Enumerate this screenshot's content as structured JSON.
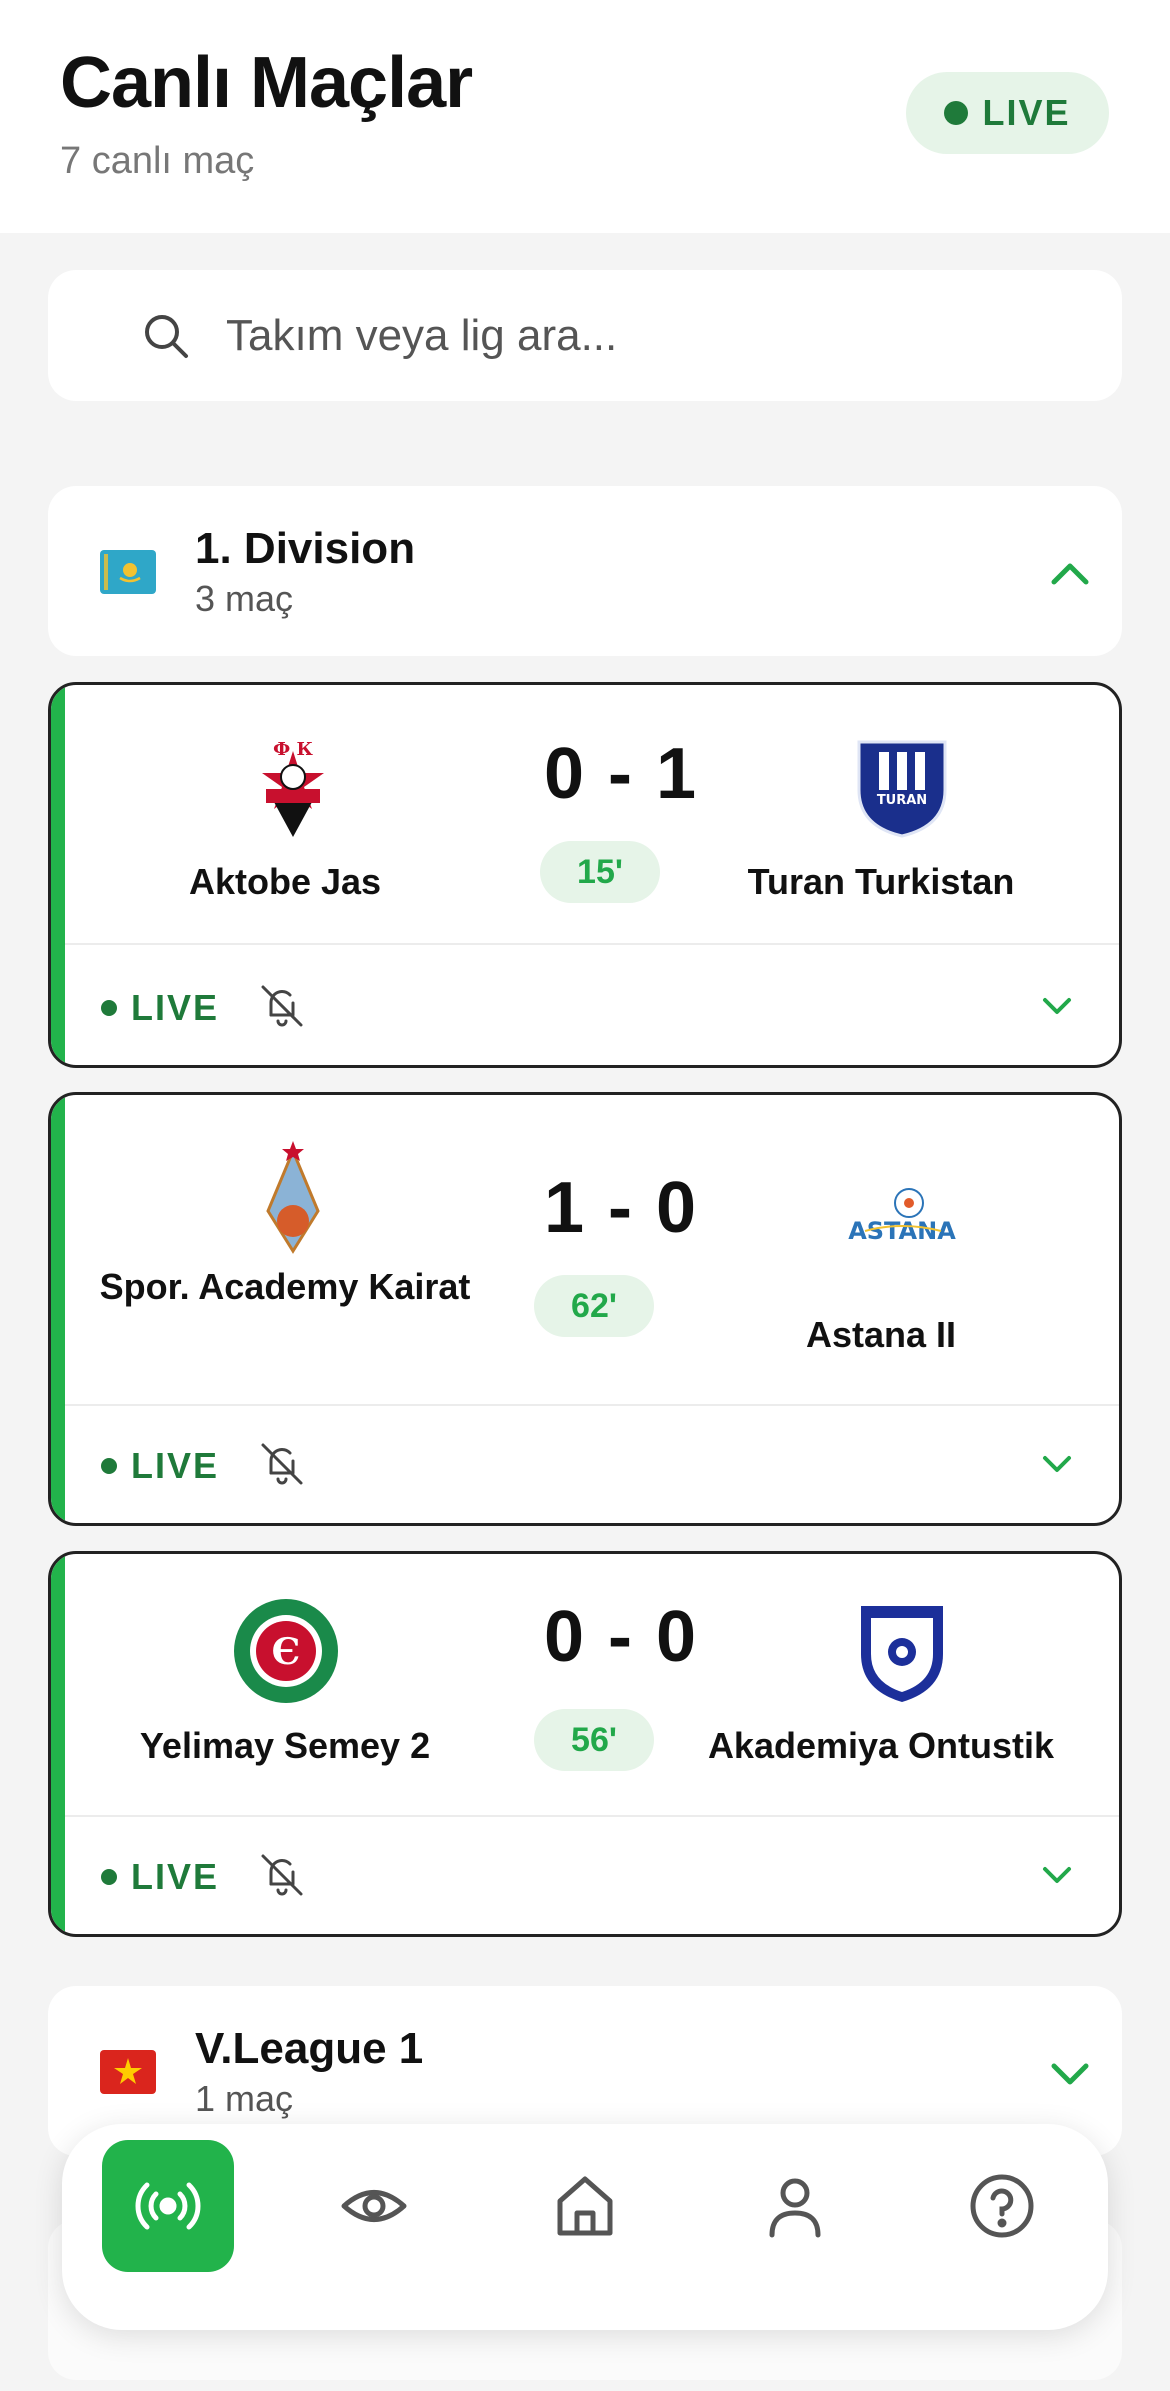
{
  "header": {
    "title": "Canlı Maçlar",
    "subtitle": "7 canlı maç",
    "live_label": "LIVE"
  },
  "search": {
    "placeholder": "Takım veya lig ara..."
  },
  "leagues": [
    {
      "name": "1. Division",
      "count": "3 maç",
      "flag": "kazakhstan-flag",
      "expanded": true,
      "matches": [
        {
          "home": "Aktobe Jas",
          "away": "Turan Turkistan",
          "score": "0 - 1",
          "minute": "15'",
          "status": "LIVE"
        },
        {
          "home": "Spor. Academy Kairat",
          "away": "Astana II",
          "score": "1 - 0",
          "minute": "62'",
          "status": "LIVE"
        },
        {
          "home": "Yelimay Semey 2",
          "away": "Akademiya Ontustik",
          "score": "0 - 0",
          "minute": "56'",
          "status": "LIVE"
        }
      ]
    },
    {
      "name": "V.League 1",
      "count": "1 maç",
      "flag": "vietnam-flag",
      "expanded": false
    }
  ],
  "nav": {
    "items": [
      {
        "icon": "live-broadcast-icon",
        "active": true
      },
      {
        "icon": "eye-icon",
        "active": false
      },
      {
        "icon": "home-icon",
        "active": false
      },
      {
        "icon": "user-icon",
        "active": false
      },
      {
        "icon": "help-icon",
        "active": false
      }
    ]
  },
  "colors": {
    "accent": "#22b34b",
    "live_text": "#1f7a3a",
    "pill_bg": "#e6f4e8",
    "page_bg": "#f4f4f4"
  }
}
